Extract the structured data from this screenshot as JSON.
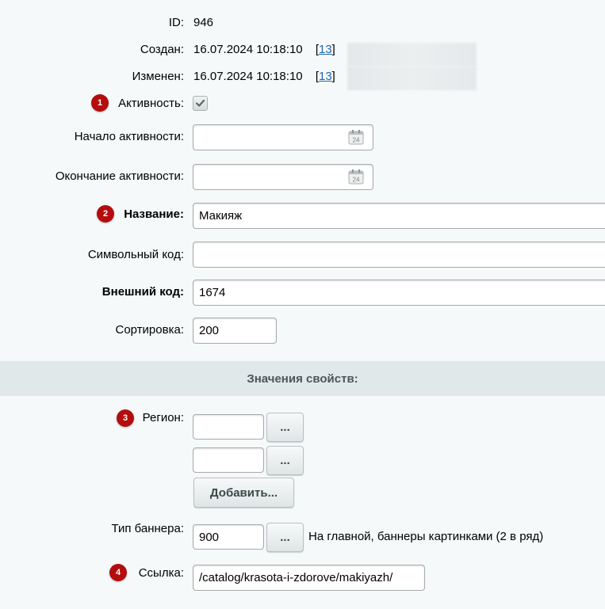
{
  "info": {
    "id_label": "ID:",
    "id_value": "946",
    "created_label": "Создан:",
    "created_value": "16.07.2024 10:18:10",
    "created_user_open": "[",
    "created_user_link": "13",
    "created_user_close": "]",
    "modified_label": "Изменен:",
    "modified_value": "16.07.2024 10:18:10",
    "modified_user_open": "[",
    "modified_user_link": "13",
    "modified_user_close": "]"
  },
  "form": {
    "active_label": "Активность:",
    "active_checked": true,
    "start_label": "Начало активности:",
    "start_value": "",
    "end_label": "Окончание активности:",
    "end_value": "",
    "calendar_icon_text": "24",
    "name_label": "Название:",
    "name_value": "Макияж",
    "code_label": "Символьный код:",
    "code_value": "",
    "xml_label": "Внешний код:",
    "xml_value": "1674",
    "sort_label": "Сортировка:",
    "sort_value": "200"
  },
  "properties": {
    "section_title": "Значения свойств:",
    "region_label": "Регион:",
    "region_values": [
      "",
      ""
    ],
    "browse_label": "...",
    "add_label": "Добавить...",
    "banner_type_label": "Тип баннера:",
    "banner_type_value": "900",
    "banner_type_desc": "На главной, баннеры картинками (2 в ряд)",
    "link_label": "Ссылка:",
    "link_value": "/catalog/krasota-i-zdorove/makiyazh/"
  },
  "badges": [
    "1",
    "2",
    "3",
    "4"
  ],
  "colors": {
    "background": "#f5f9f9",
    "badge": "#b30d0d",
    "section_bar": "#e0e8ea",
    "link": "#2067b0"
  }
}
